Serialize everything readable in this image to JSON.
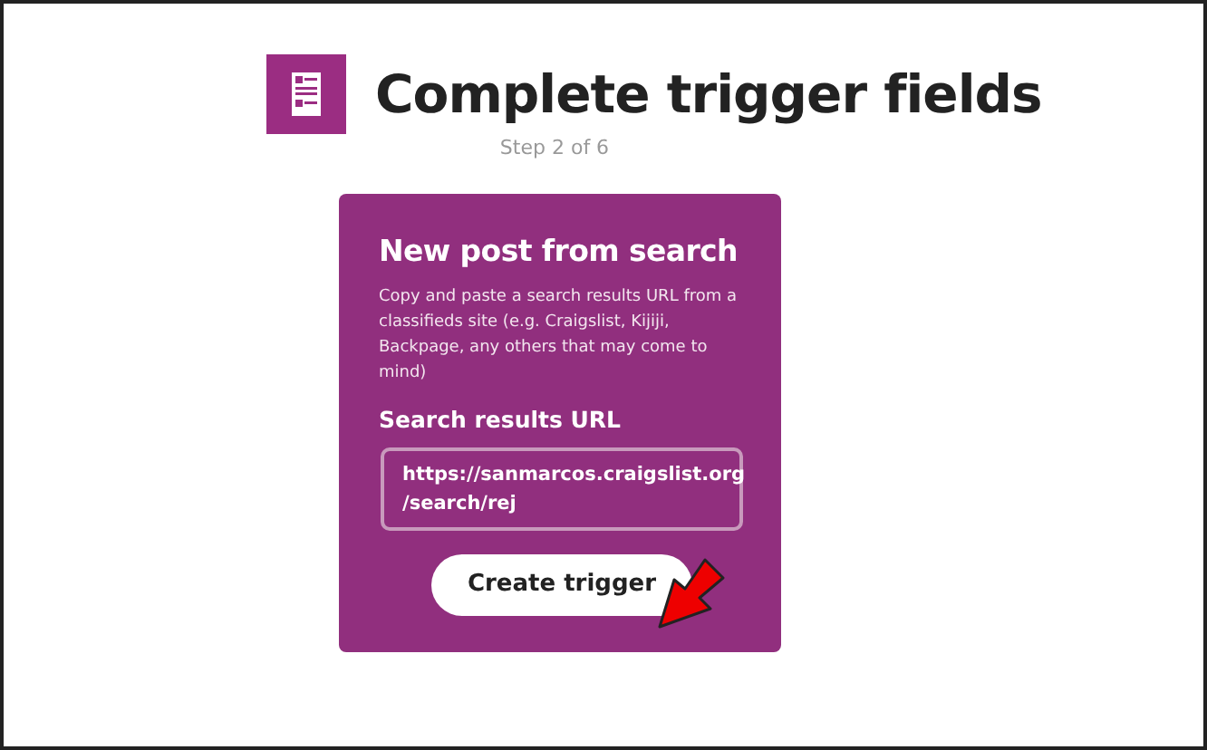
{
  "header": {
    "title": "Complete trigger fields",
    "step": "Step 2 of 6"
  },
  "card": {
    "title": "New post from search",
    "description": "Copy and paste a search results URL from a classifieds site (e.g. Craigslist, Kijiji, Backpage, any others that may come to mind)",
    "field": {
      "label": "Search results URL",
      "value_lines": [
        "https://sanmarcos.craigslist.org",
        "/search/rej"
      ]
    },
    "button": "Create trigger"
  }
}
